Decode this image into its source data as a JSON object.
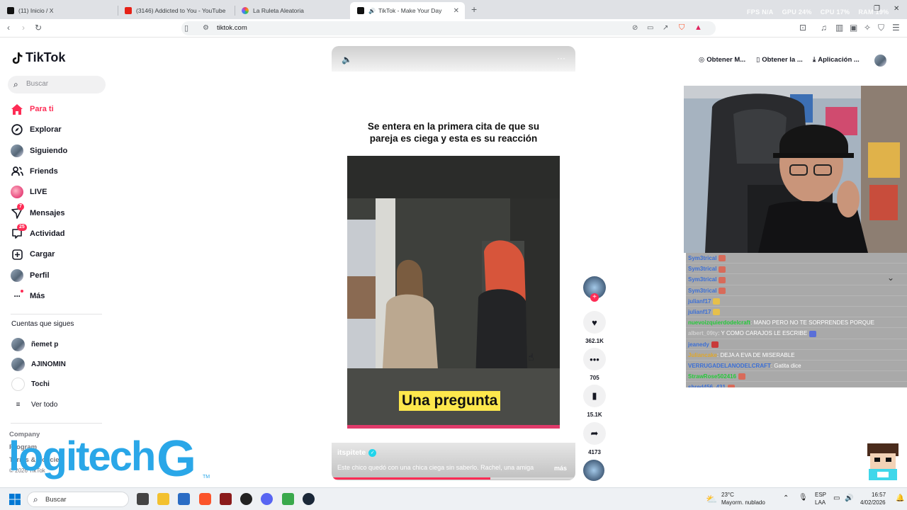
{
  "browser": {
    "tabs": [
      {
        "title": "(11) Inicio / X",
        "favicon_color": "#111111",
        "active": false
      },
      {
        "title": "(3146) Addicted to You - YouTube",
        "favicon_color": "#e62117",
        "active": false
      },
      {
        "title": "La Ruleta Aleatoria",
        "favicon_color": "#8b5cf6",
        "active": false
      },
      {
        "title": "TikTok - Make Your Day",
        "favicon_color": "#111111",
        "active": true
      }
    ],
    "new_tab": "+",
    "url": "tiktok.com",
    "perf_overlay": {
      "fps": "FPS N/A",
      "gpu": "GPU 24%",
      "cpu": "CPU 17%",
      "ram": "RAM 19%"
    }
  },
  "tiktok": {
    "logo_text": "TikTok",
    "search_placeholder": "Buscar",
    "nav": [
      {
        "label": "Para ti",
        "icon": "home-icon",
        "active": true,
        "badge": ""
      },
      {
        "label": "Explorar",
        "icon": "compass-icon",
        "active": false,
        "badge": ""
      },
      {
        "label": "Siguiendo",
        "icon": "following-avatar-icon",
        "active": false,
        "badge": ""
      },
      {
        "label": "Friends",
        "icon": "friends-icon",
        "active": false,
        "badge": ""
      },
      {
        "label": "LIVE",
        "icon": "live-icon",
        "active": false,
        "badge": ""
      },
      {
        "label": "Mensajes",
        "icon": "send-icon",
        "active": false,
        "badge": "7"
      },
      {
        "label": "Actividad",
        "icon": "activity-icon",
        "active": false,
        "badge": "25"
      },
      {
        "label": "Cargar",
        "icon": "upload-icon",
        "active": false,
        "badge": ""
      },
      {
        "label": "Perfil",
        "icon": "profile-avatar-icon",
        "active": false,
        "badge": ""
      },
      {
        "label": "Más",
        "icon": "more-dots-icon",
        "active": false,
        "badge": ""
      }
    ],
    "following_header": "Cuentas que sigues",
    "following": [
      {
        "name": "ñemet p"
      },
      {
        "name": "AJINOMIN"
      },
      {
        "name": "Tochi"
      }
    ],
    "see_all": "Ver todo",
    "footer": [
      "Company",
      "Program",
      "Terms & Policies",
      "© 2026 TikTok"
    ],
    "top_buttons": [
      "Obtener M...",
      "Obtener la ...",
      "Aplicación ..."
    ],
    "video": {
      "title": "Se entera en la primera cita de que su pareja es ciega y esta es su reacción",
      "caption": "Una pregunta",
      "author": "itspitete",
      "description": "Este chico quedó con una chica ciega sin saberlo. Rachel, una amiga",
      "more_label": "más",
      "progress": 0.65
    },
    "actions": {
      "likes": "362.1K",
      "comments": "705",
      "saves": "15.1K",
      "shares": "4173"
    }
  },
  "stream_chat": [
    {
      "user": "Sym3trical",
      "msg": "",
      "color": "#3b6fd6"
    },
    {
      "user": "Sym3trical",
      "msg": "",
      "color": "#3b6fd6"
    },
    {
      "user": "Sym3trical",
      "msg": "",
      "color": "#3b6fd6"
    },
    {
      "user": "Sym3trical",
      "msg": "",
      "color": "#3b6fd6"
    },
    {
      "user": "julianf17",
      "msg": "",
      "color": "#3b6fd6"
    },
    {
      "user": "julianf17",
      "msg": "",
      "color": "#3b6fd6"
    },
    {
      "user": "nuevoizquierdodelcraft",
      "msg": ": MANO PERO NO TE SORPRENDES PORQUE",
      "color": "#25c93a"
    },
    {
      "user": "albert_09ty",
      "msg": ": Y COMO CARAJOS LE ESCRIBE",
      "color": "#d0d0d0"
    },
    {
      "user": "jeanedy",
      "msg": "",
      "color": "#3b6fd6"
    },
    {
      "user": "Juliancake",
      "msg": ": DEJA A EVA DE MISERABLE",
      "color": "#e0a72a"
    },
    {
      "user": "VERRUGADELANODELCRAFT",
      "msg": ": Gatita dice",
      "color": "#3b6fd6"
    },
    {
      "user": "StrawRose502416",
      "msg": "",
      "color": "#25c93a"
    },
    {
      "user": "shred456_431",
      "msg": "",
      "color": "#3b6fd6"
    }
  ],
  "overlay_brand": {
    "text": "logitech",
    "mark": "G",
    "tm": "TM"
  },
  "taskbar": {
    "search_placeholder": "Buscar",
    "weather_temp": "23°C",
    "weather_desc": "Mayorm. nublado",
    "lang_top": "ESP",
    "lang_bottom": "LAA",
    "time": "16:57",
    "date": "4/02/2026"
  },
  "colors": {
    "accent": "#fe2c55",
    "logitech": "#2aa7e8"
  }
}
